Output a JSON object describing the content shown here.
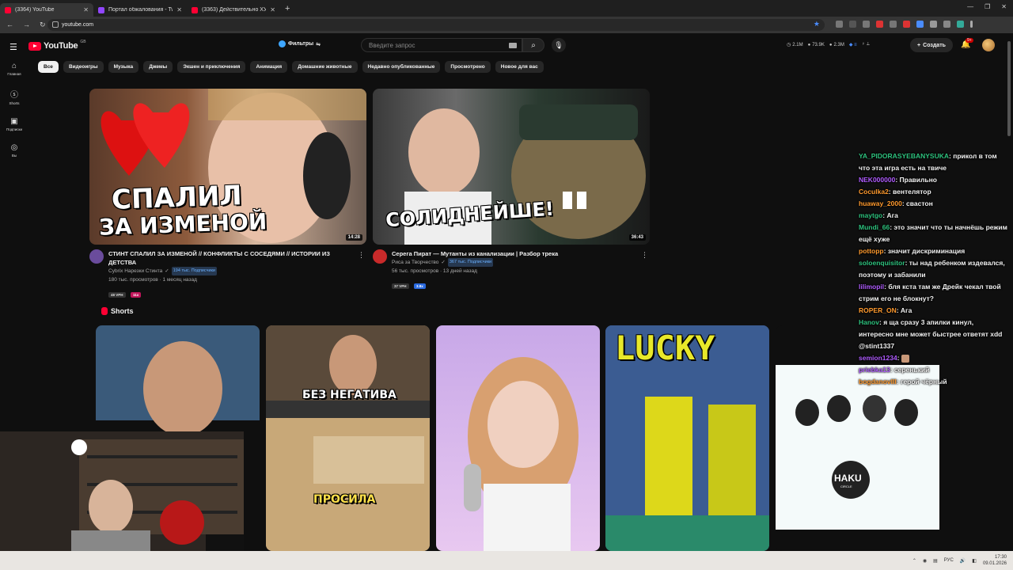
{
  "browser": {
    "tabs": [
      {
        "title": "(3364) YouTube",
        "color": "#ff0033",
        "active": true
      },
      {
        "title": "Портал обжалования - Twitch",
        "color": "#9146ff",
        "active": false
      },
      {
        "title": "(3363) Действительно ХУДШ...",
        "color": "#ff0033",
        "active": false
      }
    ],
    "url": "youtube.com"
  },
  "youtube": {
    "logo_text": "YouTube",
    "logo_sup": "GB",
    "filter_label": "Фильтры",
    "search_placeholder": "Введите запрос",
    "stats": [
      "2.1M",
      "73.9K",
      "2.3M"
    ],
    "create_label": "Создать",
    "notifications": "9+",
    "chips": [
      "Все",
      "Видеоигры",
      "Музыка",
      "Джемы",
      "Экшен и приключения",
      "Анимация",
      "Домашние животные",
      "Недавно опубликованные",
      "Просмотрено",
      "Новое для вас"
    ],
    "sidebar": [
      {
        "label": "Главная",
        "icon": "home-icon"
      },
      {
        "label": "Shorts",
        "icon": "shorts-icon"
      },
      {
        "label": "Подписки",
        "icon": "subscriptions-icon"
      },
      {
        "label": "Вы",
        "icon": "you-icon"
      }
    ],
    "videos": [
      {
        "title": "СТИНТ СПАЛИЛ ЗА ИЗМЕНОЙ // КОНФЛИКТЫ С СОСЕДЯМИ // ИСТОРИИ ИЗ ДЕТСТВА",
        "channel": "Cybrix Нарезки Стинта",
        "subs": "194 тыс. Подписчики",
        "stats": "180 тыс. просмотров · 1 месяц назад",
        "duration": "14:28",
        "thumb_text_1": "СПАЛИЛ",
        "thumb_text_2": "ЗА ИЗМЕНОЙ",
        "badges": [
          "48 VPH",
          "11x"
        ]
      },
      {
        "title": "Серега Пират — Мутанты из канализации | Разбор трека",
        "channel": "Риса за Творчество",
        "subs": "367 тыс. Подписчики",
        "stats": "56 тыс. просмотров · 13 дней назад",
        "duration": "36:43",
        "thumb_text_1": "СОЛИДНЕЙШЕ!",
        "badges": [
          "37 VPH",
          "3.8x"
        ]
      }
    ],
    "shorts_title": "Shorts",
    "shorts": [
      {
        "caption": ""
      },
      {
        "caption": "БЕЗ НЕГАТИВА",
        "caption2": "ПРОСИЛА"
      },
      {
        "caption": ""
      },
      {
        "caption": "LUCKY"
      },
      {
        "caption": "HAKU",
        "caption2": "CIRCLE"
      }
    ]
  },
  "chat": [
    {
      "user": "YA_PIDORASYEBANYSUKA",
      "color": "#2ec27e",
      "text": "прикол в том что эта игра есть на твиче"
    },
    {
      "user": "NEK000000",
      "color": "#b05cff",
      "text": "Правильно"
    },
    {
      "user": "Coculka2",
      "color": "#ff9a2e",
      "text": "вентелятор"
    },
    {
      "user": "huaway_2000",
      "color": "#ff9a2e",
      "text": "свастон"
    },
    {
      "user": "maytgo",
      "color": "#2ec27e",
      "text": "Ага"
    },
    {
      "user": "Mundi_66",
      "color": "#2ec27e",
      "text": "это значит что ты начнёшь режим ещё хуже"
    },
    {
      "user": "pottopp",
      "color": "#ff9a2e",
      "text": "значит дискриминация"
    },
    {
      "user": "soloenquisitor",
      "color": "#2ec27e",
      "text": "ты над ребенком издевался, поэтому и забанили"
    },
    {
      "user": "lilimopil",
      "color": "#b05cff",
      "text": "бля кста там же Дрейк чекал твой стрим его не блокнут?"
    },
    {
      "user": "ROPER_ON",
      "color": "#ff9a2e",
      "text": "Ага"
    },
    {
      "user": "Hanov",
      "color": "#2ec27e",
      "text": "я ща сразу 3 апилки кинул, интересно мне может быстрее ответят xdd @stint1337"
    },
    {
      "user": "semion1234",
      "color": "#b05cff",
      "text": ""
    },
    {
      "user": "priebka13",
      "color": "#b05cff",
      "text": "серенький"
    },
    {
      "user": "bogdanovIII",
      "color": "#ff9a2e",
      "text": "герой чёрный"
    }
  ],
  "taskbar": {
    "lang": "РУС",
    "time": "17:30",
    "date": "09.01.2026"
  }
}
